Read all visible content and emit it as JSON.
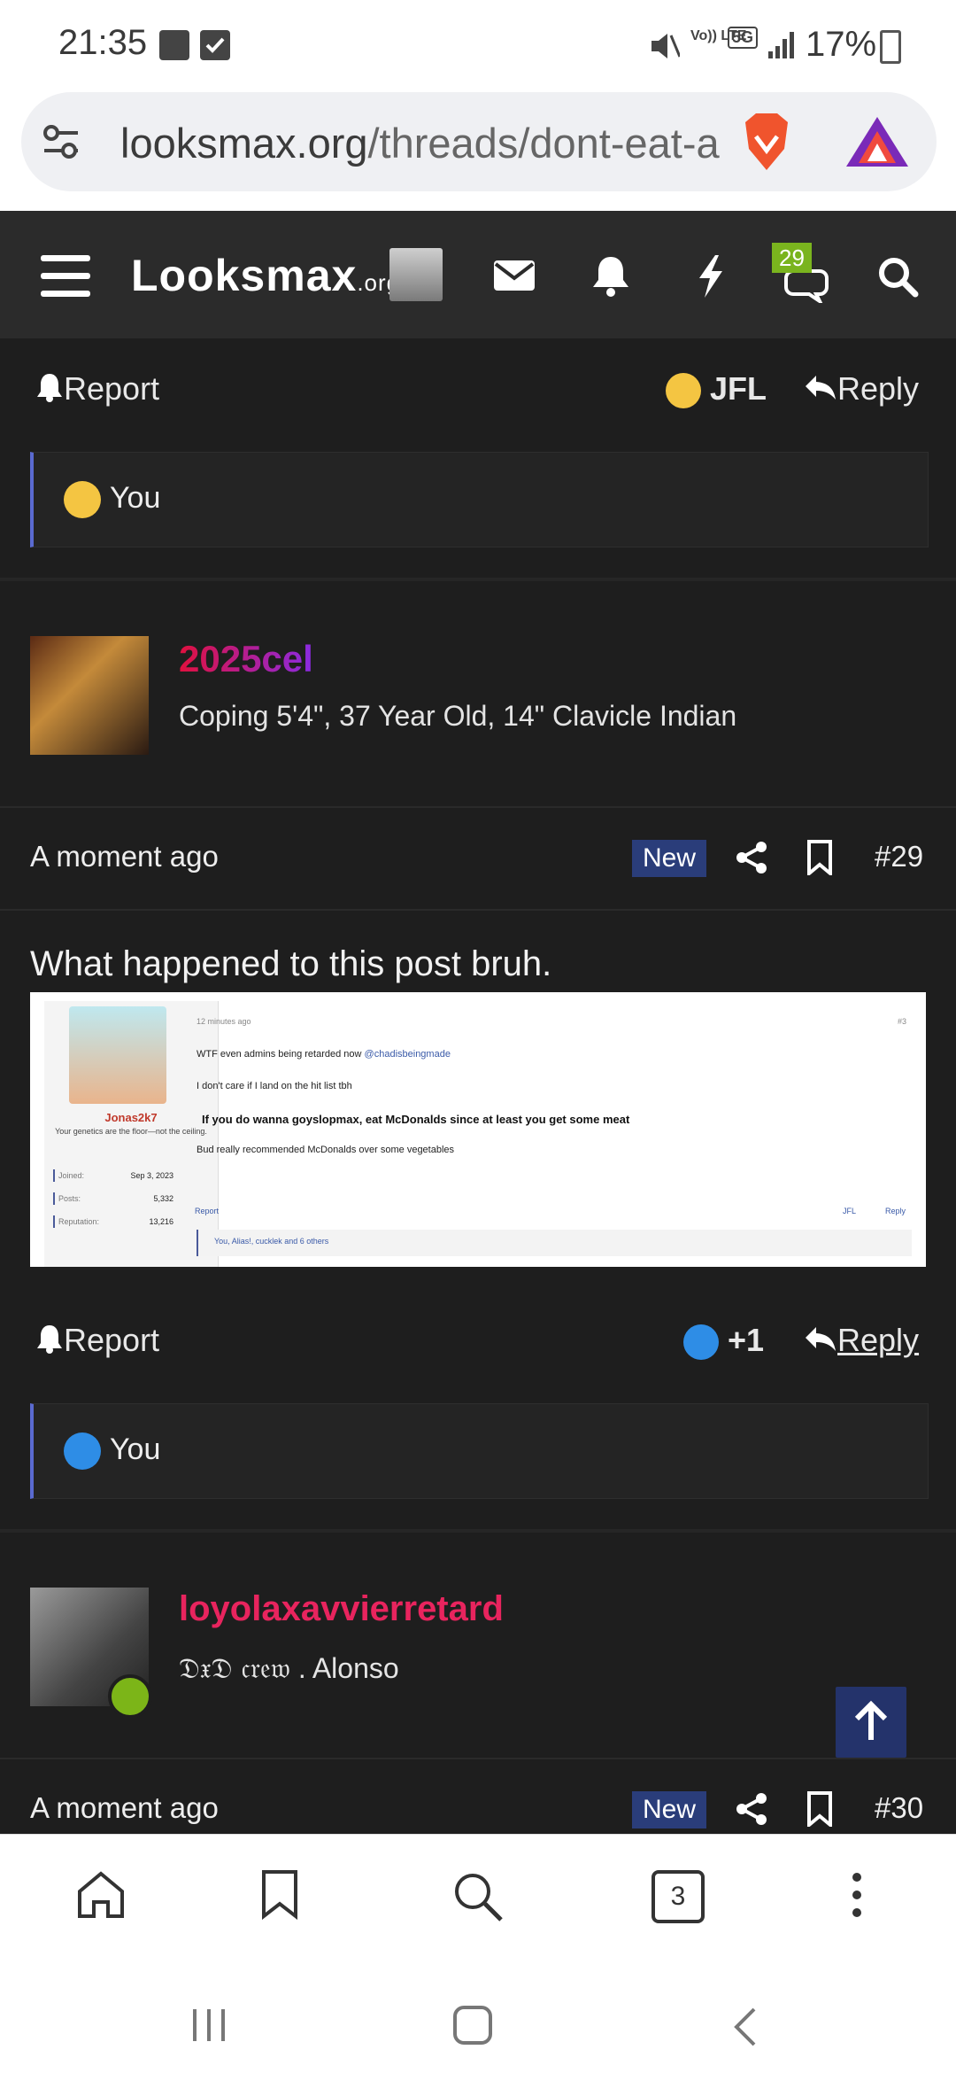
{
  "status_bar": {
    "time": "21:35",
    "signal_text": "Vo)) LTE",
    "network": "5G",
    "battery": "17%"
  },
  "browser": {
    "url_domain": "looksmax.org",
    "url_path": "/threads/dont-eat-a"
  },
  "site_header": {
    "logo": "Looksmax",
    "logo_suffix": ".org",
    "conversations_badge": "29"
  },
  "post_prev": {
    "report_label": "Report",
    "reaction_label": "JFL",
    "reply_label": "Reply",
    "reaction_summary": "You"
  },
  "post_29": {
    "username": "2025cel",
    "user_title": "Coping 5'4\", 37 Year Old, 14\" Clavicle Indian",
    "time": "A moment ago",
    "new_badge": "New",
    "number": "#29",
    "text": "What happened to this post bruh.",
    "embed": {
      "username": "Jonas2k7",
      "signature": "Your genetics are the floor—not the ceiling.",
      "stats": [
        {
          "label": "Joined:",
          "value": "Sep 3, 2023"
        },
        {
          "label": "Posts:",
          "value": "5,332"
        },
        {
          "label": "Reputation:",
          "value": "13,216"
        }
      ],
      "time": "12 minutes ago",
      "number": "#3",
      "line1": "WTF even admins being retarded now",
      "mention": "@chadisbeingmade",
      "line2": "I don't care if I land on the hit list tbh",
      "line3": "If you do wanna goyslopmax, eat McDonalds since at least you get some meat",
      "line4": "Bud really recommended McDonalds over some vegetables",
      "report": "Report",
      "jfl": "JFL",
      "reply": "Reply",
      "reactions": "You, Alias!, cucklek and 6 others"
    },
    "report_label": "Report",
    "reaction_count": "+1",
    "reply_label": "Reply",
    "reaction_summary": "You"
  },
  "post_30": {
    "username": "loyolaxavvierretard",
    "user_title_gothic": "𝔇𝔵𝔇 𝔠𝔯𝔢𝔴",
    "user_title_rest": " . Alonso",
    "time": "A moment ago",
    "new_badge": "New",
    "number": "#30"
  },
  "bottom_nav": {
    "tabs_count": "3"
  },
  "colors": {
    "accent_blue": "#2a3d7a",
    "username_pink": "#e8245e",
    "badge_green": "#7ab41e",
    "online_green": "#7cb518"
  }
}
